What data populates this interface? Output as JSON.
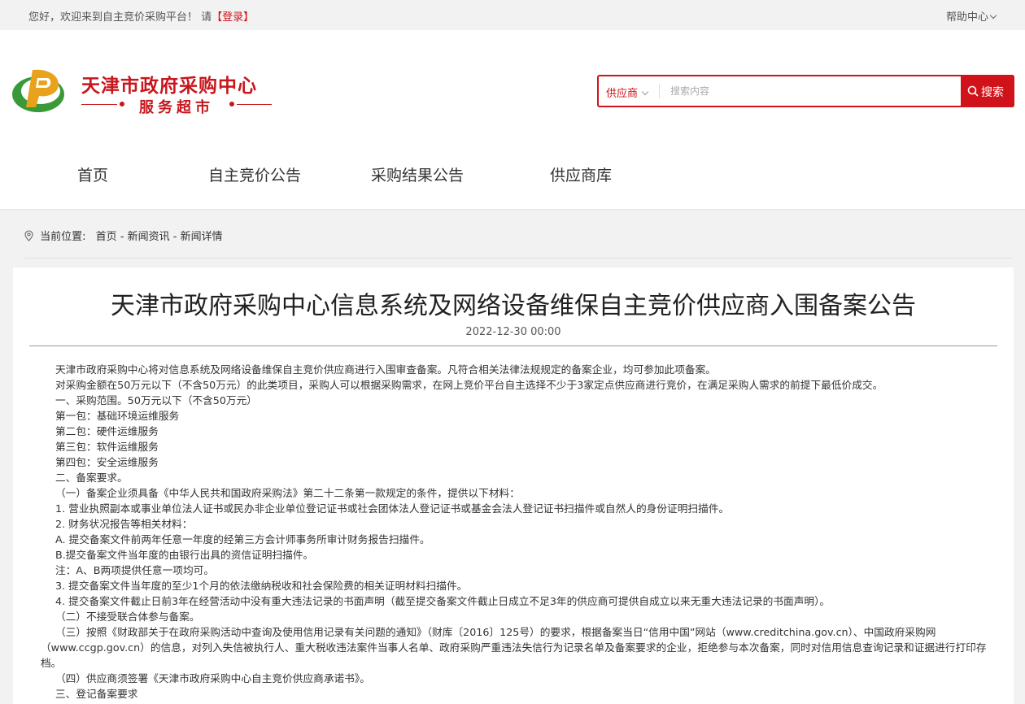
{
  "topbar": {
    "welcome": "您好，欢迎来到自主竞价采购平台！ 请",
    "login": "【登录】",
    "help": "帮助中心"
  },
  "logo": {
    "title": "天津市政府采购中心",
    "subtitle": "服务超市"
  },
  "search": {
    "category": "供应商",
    "placeholder": "搜索内容",
    "button": "搜索"
  },
  "nav": {
    "items": [
      "首页",
      "自主竞价公告",
      "采购结果公告",
      "供应商库"
    ]
  },
  "breadcrumb": {
    "label": "当前位置:",
    "home": "首页",
    "news": "新闻资讯",
    "detail": "新闻详情",
    "sep": " - "
  },
  "article": {
    "title": "天津市政府采购中心信息系统及网络设备维保自主竞价供应商入围备案公告",
    "date": "2022-12-30 00:00",
    "paragraphs": [
      "天津市政府采购中心将对信息系统及网络设备维保自主竞价供应商进行入围审查备案。凡符合相关法律法规规定的备案企业，均可参加此项备案。",
      "对采购金额在50万元以下（不含50万元）的此类项目，采购人可以根据采购需求，在网上竞价平台自主选择不少于3家定点供应商进行竞价，在满足采购人需求的前提下最低价成交。",
      "一、采购范围。50万元以下（不含50万元）",
      "第一包：基础环境运维服务",
      "第二包：硬件运维服务",
      "第三包：软件运维服务",
      "第四包：安全运维服务",
      "二、备案要求。",
      "（一）备案企业须具备《中华人民共和国政府采购法》第二十二条第一款规定的条件，提供以下材料：",
      "1. 营业执照副本或事业单位法人证书或民办非企业单位登记证书或社会团体法人登记证书或基金会法人登记证书扫描件或自然人的身份证明扫描件。",
      "2. 财务状况报告等相关材料：",
      "A. 提交备案文件前两年任意一年度的经第三方会计师事务所审计财务报告扫描件。",
      "B.提交备案文件当年度的由银行出具的资信证明扫描件。",
      "注：A、B两项提供任意一项均可。",
      "3. 提交备案文件当年度的至少1个月的依法缴纳税收和社会保险费的相关证明材料扫描件。",
      "4. 提交备案文件截止日前3年在经营活动中没有重大违法记录的书面声明（截至提交备案文件截止日成立不足3年的供应商可提供自成立以来无重大违法记录的书面声明）。",
      "（二）不接受联合体参与备案。",
      "（三）按照《财政部关于在政府采购活动中查询及使用信用记录有关问题的通知》（财库〔2016〕125号）的要求，根据备案当日“信用中国”网站（www.creditchina.gov.cn）、中国政府采购网（www.ccgp.gov.cn）的信息，对列入失信被执行人、重大税收违法案件当事人名单、政府采购严重违法失信行为记录名单及备案要求的企业，拒绝参与本次备案，同时对信用信息查询记录和证据进行打印存档。",
      "（四）供应商须签署《天津市政府采购中心自主竞价供应商承诺书》。",
      "三、登记备案要求"
    ]
  },
  "colors": {
    "brand_red": "#d0131a",
    "logo_green": "#3a9a3a",
    "logo_orange": "#e8a21b"
  }
}
